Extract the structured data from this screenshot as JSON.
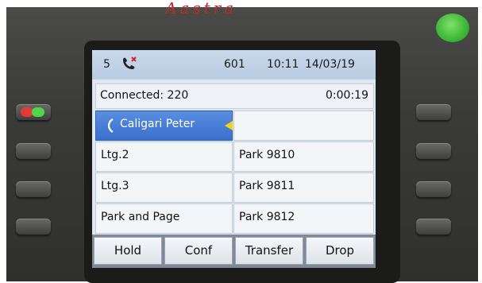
{
  "status": {
    "line_count": "5",
    "extension": "601",
    "time": "10:11",
    "date": "14/03/19"
  },
  "call": {
    "connected_label": "Connected: 220",
    "duration": "0:00:19"
  },
  "lines": [
    {
      "left": "Caligari Peter",
      "right": ""
    },
    {
      "left": "Ltg.2",
      "right": "Park 9810"
    },
    {
      "left": "Ltg.3",
      "right": "Park 9811"
    },
    {
      "left": "Park and Page",
      "right": "Park 9812"
    }
  ],
  "softkeys": [
    "Hold",
    "Conf",
    "Transfer",
    "Drop"
  ],
  "colors": {
    "active_line": "#3a6fcc",
    "led": "#33b02e",
    "brand": "#c0282a"
  }
}
